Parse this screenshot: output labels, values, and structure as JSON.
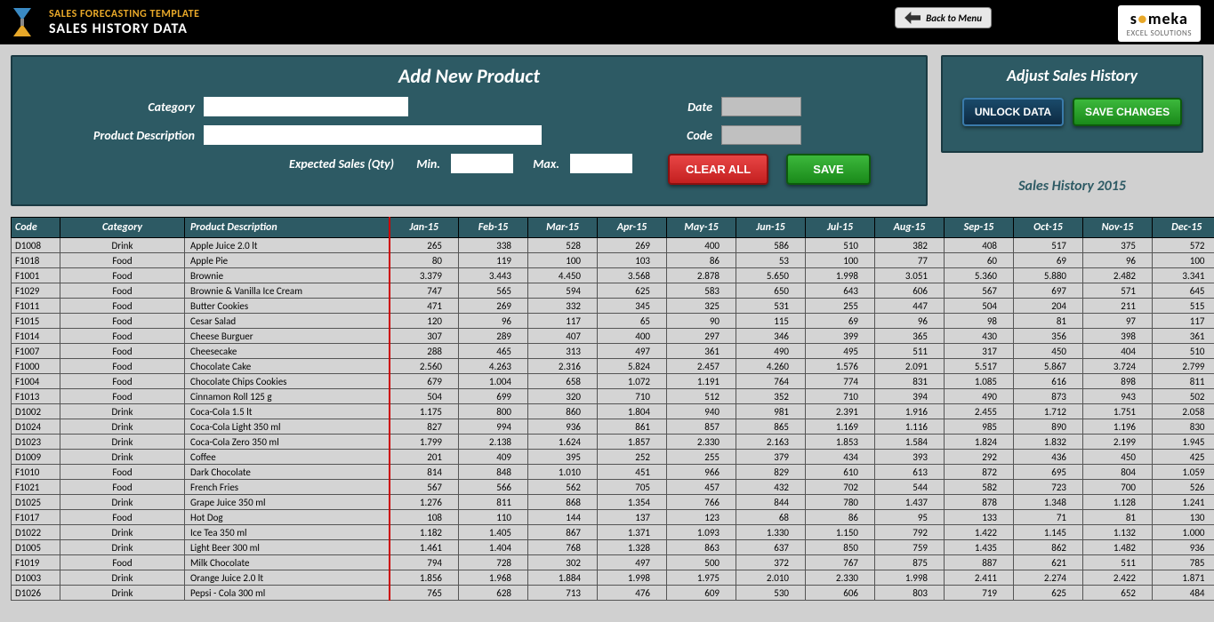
{
  "header": {
    "template_title": "SALES FORECASTING TEMPLATE",
    "page_title": "SALES HISTORY DATA",
    "back_label": "Back to Menu",
    "brand": "someka",
    "brand_sub": "EXCEL SOLUTIONS"
  },
  "add_product": {
    "title": "Add New Product",
    "category_label": "Category",
    "desc_label": "Product Description",
    "date_label": "Date",
    "code_label": "Code",
    "expected_label": "Expected Sales (Qty)",
    "min_label": "Min.",
    "max_label": "Max.",
    "clear_btn": "CLEAR ALL",
    "save_btn": "SAVE"
  },
  "adjust": {
    "title": "Adjust Sales History",
    "unlock_btn": "UNLOCK DATA",
    "save_btn": "SAVE CHANGES",
    "history_label": "Sales History 2015"
  },
  "table": {
    "headers": [
      "Code",
      "Category",
      "Product Description",
      "Jan-15",
      "Feb-15",
      "Mar-15",
      "Apr-15",
      "May-15",
      "Jun-15",
      "Jul-15",
      "Aug-15",
      "Sep-15",
      "Oct-15",
      "Nov-15",
      "Dec-15"
    ],
    "rows": [
      {
        "code": "D1008",
        "cat": "Drink",
        "desc": "Apple Juice 2.0 lt",
        "v": [
          "265",
          "338",
          "528",
          "269",
          "400",
          "586",
          "510",
          "382",
          "408",
          "517",
          "375",
          "572"
        ]
      },
      {
        "code": "F1018",
        "cat": "Food",
        "desc": "Apple Pie",
        "v": [
          "80",
          "119",
          "100",
          "103",
          "86",
          "53",
          "100",
          "77",
          "60",
          "69",
          "96",
          "100"
        ]
      },
      {
        "code": "F1001",
        "cat": "Food",
        "desc": "Brownie",
        "v": [
          "3.379",
          "3.443",
          "4.450",
          "3.568",
          "2.878",
          "5.650",
          "1.998",
          "3.051",
          "5.360",
          "5.880",
          "2.482",
          "3.341"
        ]
      },
      {
        "code": "F1029",
        "cat": "Food",
        "desc": "Brownie & Vanilla Ice Cream",
        "v": [
          "747",
          "565",
          "594",
          "625",
          "583",
          "650",
          "643",
          "606",
          "567",
          "697",
          "571",
          "645"
        ]
      },
      {
        "code": "F1011",
        "cat": "Food",
        "desc": "Butter Cookies",
        "v": [
          "471",
          "269",
          "332",
          "345",
          "325",
          "531",
          "255",
          "447",
          "504",
          "204",
          "211",
          "515"
        ]
      },
      {
        "code": "F1015",
        "cat": "Food",
        "desc": "Cesar Salad",
        "v": [
          "120",
          "96",
          "117",
          "65",
          "90",
          "115",
          "69",
          "96",
          "98",
          "81",
          "97",
          "117"
        ]
      },
      {
        "code": "F1014",
        "cat": "Food",
        "desc": "Cheese Burguer",
        "v": [
          "307",
          "289",
          "407",
          "400",
          "297",
          "346",
          "399",
          "365",
          "430",
          "356",
          "398",
          "361"
        ]
      },
      {
        "code": "F1007",
        "cat": "Food",
        "desc": "Cheesecake",
        "v": [
          "288",
          "465",
          "313",
          "497",
          "361",
          "490",
          "495",
          "511",
          "317",
          "450",
          "404",
          "510"
        ]
      },
      {
        "code": "F1000",
        "cat": "Food",
        "desc": "Chocolate Cake",
        "v": [
          "2.560",
          "4.263",
          "2.316",
          "5.824",
          "2.457",
          "4.260",
          "1.576",
          "2.091",
          "5.517",
          "5.867",
          "3.724",
          "2.799"
        ]
      },
      {
        "code": "F1004",
        "cat": "Food",
        "desc": "Chocolate Chips Cookies",
        "v": [
          "679",
          "1.004",
          "658",
          "1.072",
          "1.191",
          "764",
          "774",
          "831",
          "1.085",
          "616",
          "898",
          "811"
        ]
      },
      {
        "code": "F1013",
        "cat": "Food",
        "desc": "Cinnamon Roll 125 g",
        "v": [
          "504",
          "699",
          "320",
          "710",
          "512",
          "352",
          "710",
          "394",
          "490",
          "873",
          "943",
          "502"
        ]
      },
      {
        "code": "D1002",
        "cat": "Drink",
        "desc": "Coca-Cola 1.5 lt",
        "v": [
          "1.175",
          "800",
          "860",
          "1.804",
          "940",
          "981",
          "2.391",
          "1.916",
          "2.455",
          "1.712",
          "1.751",
          "2.058"
        ]
      },
      {
        "code": "D1024",
        "cat": "Drink",
        "desc": "Coca-Cola Light 350 ml",
        "v": [
          "827",
          "994",
          "936",
          "861",
          "857",
          "865",
          "1.169",
          "1.116",
          "985",
          "890",
          "1.196",
          "830"
        ]
      },
      {
        "code": "D1023",
        "cat": "Drink",
        "desc": "Coca-Cola Zero 350 ml",
        "v": [
          "1.799",
          "2.138",
          "1.624",
          "1.857",
          "2.330",
          "2.163",
          "1.853",
          "1.584",
          "1.824",
          "1.832",
          "2.199",
          "1.945"
        ]
      },
      {
        "code": "D1009",
        "cat": "Drink",
        "desc": "Coffee",
        "v": [
          "201",
          "409",
          "395",
          "252",
          "255",
          "379",
          "434",
          "393",
          "292",
          "436",
          "450",
          "425"
        ]
      },
      {
        "code": "F1010",
        "cat": "Food",
        "desc": "Dark Chocolate",
        "v": [
          "814",
          "848",
          "1.010",
          "451",
          "966",
          "829",
          "610",
          "613",
          "872",
          "695",
          "804",
          "1.059"
        ]
      },
      {
        "code": "F1021",
        "cat": "Food",
        "desc": "French Fries",
        "v": [
          "567",
          "566",
          "562",
          "705",
          "457",
          "432",
          "702",
          "544",
          "582",
          "723",
          "700",
          "526"
        ]
      },
      {
        "code": "D1025",
        "cat": "Drink",
        "desc": "Grape Juice 350 ml",
        "v": [
          "1.276",
          "811",
          "868",
          "1.354",
          "766",
          "844",
          "780",
          "1.437",
          "878",
          "1.348",
          "1.128",
          "1.241"
        ]
      },
      {
        "code": "F1017",
        "cat": "Food",
        "desc": "Hot Dog",
        "v": [
          "108",
          "110",
          "144",
          "137",
          "123",
          "68",
          "86",
          "95",
          "133",
          "71",
          "81",
          "130"
        ]
      },
      {
        "code": "D1022",
        "cat": "Drink",
        "desc": "Ice Tea 350 ml",
        "v": [
          "1.182",
          "1.405",
          "867",
          "1.371",
          "1.093",
          "1.330",
          "1.150",
          "792",
          "1.422",
          "1.145",
          "1.132",
          "1.000"
        ]
      },
      {
        "code": "D1005",
        "cat": "Drink",
        "desc": "Light Beer 300 ml",
        "v": [
          "1.461",
          "1.404",
          "768",
          "1.328",
          "863",
          "637",
          "850",
          "759",
          "1.435",
          "862",
          "1.482",
          "936"
        ]
      },
      {
        "code": "F1019",
        "cat": "Food",
        "desc": "Milk Chocolate",
        "v": [
          "794",
          "728",
          "302",
          "497",
          "500",
          "372",
          "767",
          "875",
          "887",
          "621",
          "511",
          "785"
        ]
      },
      {
        "code": "D1003",
        "cat": "Drink",
        "desc": "Orange Juice 2.0 lt",
        "v": [
          "1.856",
          "1.968",
          "1.884",
          "1.998",
          "1.975",
          "2.010",
          "2.330",
          "1.998",
          "2.411",
          "2.274",
          "2.422",
          "1.871"
        ]
      },
      {
        "code": "D1026",
        "cat": "Drink",
        "desc": "Pepsi - Cola 300 ml",
        "v": [
          "765",
          "628",
          "713",
          "476",
          "609",
          "530",
          "606",
          "803",
          "719",
          "625",
          "652",
          "484"
        ]
      }
    ]
  }
}
